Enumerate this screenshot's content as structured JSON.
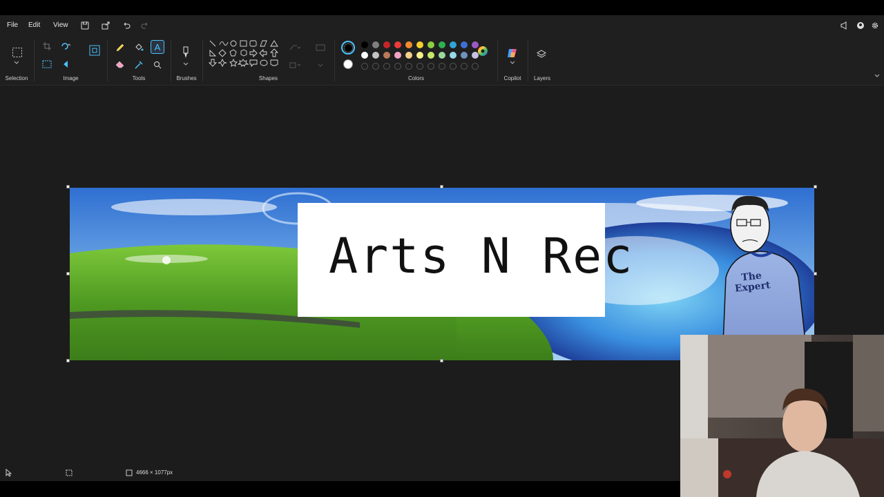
{
  "menu": {
    "file": "File",
    "edit": "Edit",
    "view": "View"
  },
  "ribbon": {
    "groups": {
      "selection": "Selection",
      "image": "Image",
      "tools": "Tools",
      "brushes": "Brushes",
      "shapes": "Shapes",
      "colors": "Colors",
      "copilot": "Copilot",
      "layers": "Layers"
    },
    "palette_row1": [
      "#000000",
      "#7f7f7f",
      "#c3262a",
      "#ee3a3a",
      "#f28b2e",
      "#f5cf2f",
      "#8dcf3f",
      "#2cb24f",
      "#2fa4d6",
      "#3f6fd6",
      "#9b59c6"
    ],
    "palette_row2": [
      "#ffffff",
      "#c3c3c3",
      "#b97a57",
      "#f3a2c3",
      "#f5d08a",
      "#f7f08a",
      "#c5e86a",
      "#9ad8a0",
      "#99d9ea",
      "#7092be",
      "#c8bfe7"
    ],
    "active_color_primary": "#000000",
    "active_color_secondary": "#ffffff"
  },
  "canvas": {
    "banner_text": "Arts N Rec",
    "shirt_text_line1": "The",
    "shirt_text_line2": "Expert"
  },
  "status": {
    "dimensions": "4666 × 1077px"
  },
  "colors": {
    "accent": "#4cc2ff",
    "app_bg": "#1c1c1c",
    "ribbon_bg": "#1f1f1f"
  }
}
